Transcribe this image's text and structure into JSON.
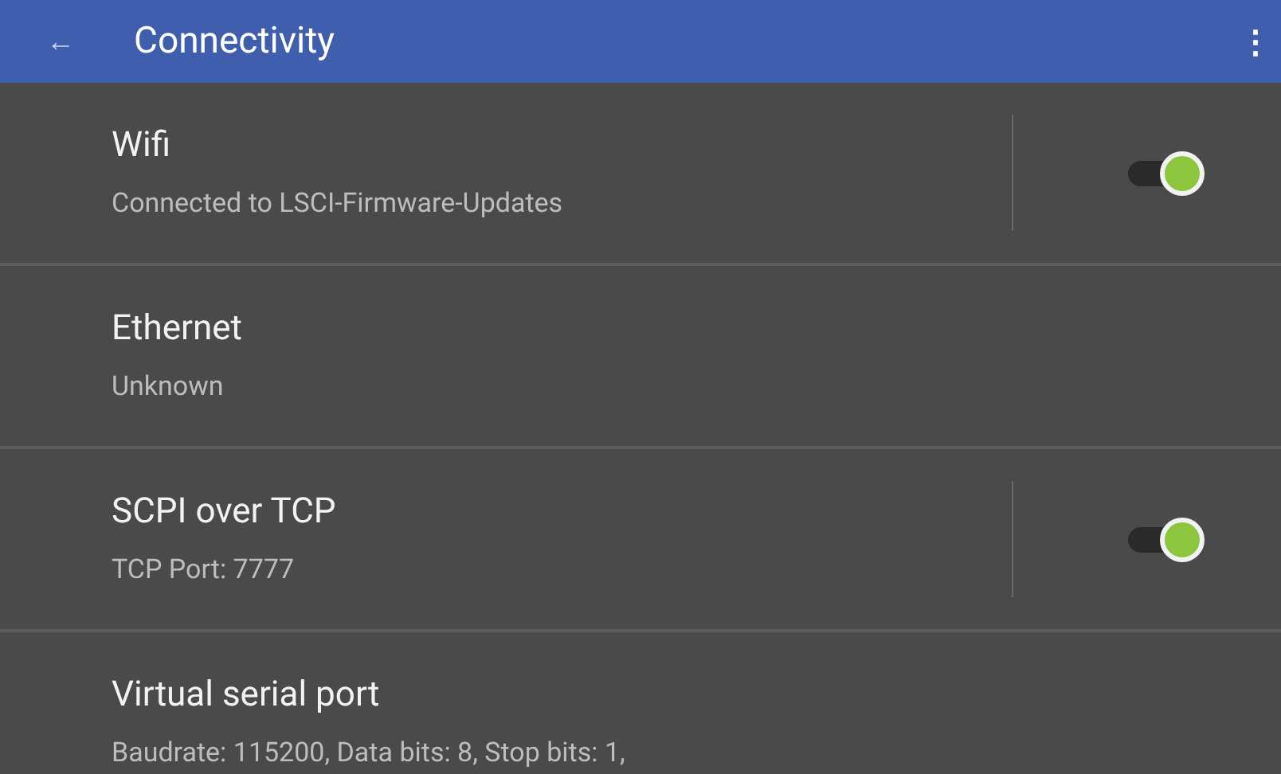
{
  "app_bar": {
    "back": "←",
    "title": "Connectivity",
    "menu": "⋮"
  },
  "settings": [
    {
      "kind": "switch",
      "title": "Wifi",
      "summary": "Connected to LSCI-Firmware-Updates",
      "on": true
    },
    {
      "kind": "plain",
      "title": "Ethernet",
      "summary": "Unknown"
    },
    {
      "kind": "switch",
      "title": "SCPI over TCP",
      "summary": "TCP Port: 7777",
      "on": true
    },
    {
      "kind": "plain",
      "title": "Virtual serial port",
      "summary": "Baudrate: 115200, Data bits: 8, Stop bits: 1,"
    }
  ]
}
